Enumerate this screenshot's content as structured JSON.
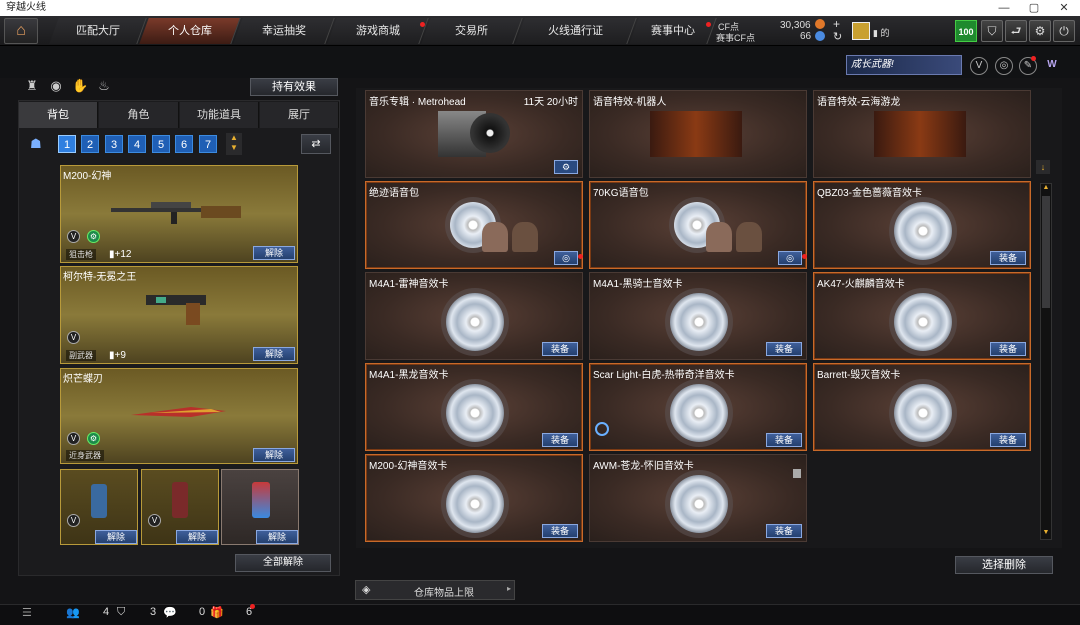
{
  "window": {
    "title": "穿越火线",
    "min": "—",
    "max": "▢",
    "close": "✕"
  },
  "nav": {
    "tabs": [
      "匹配大厅",
      "个人仓库",
      "幸运抽奖",
      "游戏商城",
      "交易所",
      "火线通行证",
      "赛事中心"
    ],
    "cf_label": "CF点",
    "cf_value": "30,306",
    "event_cf_label": "赛事CF点",
    "event_cf_value": "66",
    "plus": "+",
    "refresh": "↻",
    "player_suffix": "的",
    "level": "100"
  },
  "banner": {
    "growth_weapon": "成长武器!"
  },
  "left": {
    "effect_button": "持有效果",
    "subtabs": [
      "背包",
      "角色",
      "功能道具",
      "展厅"
    ],
    "pages": [
      "1",
      "2",
      "3",
      "4",
      "5",
      "6",
      "7"
    ],
    "weapons": [
      {
        "name": "M200-幻神",
        "tag": "狙击枪",
        "plus": "+12",
        "action": "解除"
      },
      {
        "name": "柯尔特-无冕之王",
        "tag": "副武器",
        "plus": "+9",
        "action": "解除"
      },
      {
        "name": "炽芒蝶刃",
        "tag": "近身武器",
        "plus": "",
        "action": "解除"
      }
    ],
    "grenades": [
      {
        "action": "解除"
      },
      {
        "action": "解除"
      },
      {
        "action": "解除"
      }
    ],
    "unequip_all": "全部解除"
  },
  "items": [
    {
      "name": "音乐专辑 · Metrohead",
      "time": "11天 20小时",
      "button": ""
    },
    {
      "name": "语音特效-机器人",
      "time": "",
      "button": ""
    },
    {
      "name": "语音特效-云海游龙",
      "time": "",
      "button": ""
    },
    {
      "name": "绝迹语音包",
      "time": "",
      "button": ""
    },
    {
      "name": "70KG语音包",
      "time": "",
      "button": ""
    },
    {
      "name": "QBZ03-金色蔷薇音效卡",
      "time": "",
      "button": "装备"
    },
    {
      "name": "M4A1-雷神音效卡",
      "time": "",
      "button": "装备"
    },
    {
      "name": "M4A1-黑骑士音效卡",
      "time": "",
      "button": "装备"
    },
    {
      "name": "AK47-火麒麟音效卡",
      "time": "",
      "button": "装备"
    },
    {
      "name": "M4A1-黑龙音效卡",
      "time": "",
      "button": "装备"
    },
    {
      "name": "Scar Light-白虎-热带奇洋音效卡",
      "time": "",
      "button": "装备"
    },
    {
      "name": "Barrett-毁灭音效卡",
      "time": "",
      "button": "装备"
    },
    {
      "name": "M200-幻神音效卡",
      "time": "",
      "button": "装备"
    },
    {
      "name": "AWM-苍龙-怀旧音效卡",
      "time": "",
      "button": "装备"
    }
  ],
  "footer": {
    "storage_limit": "仓库物品上限",
    "select_delete": "选择删除",
    "count_a": "4",
    "count_b": "3",
    "count_c": "0",
    "count_d": "6"
  }
}
